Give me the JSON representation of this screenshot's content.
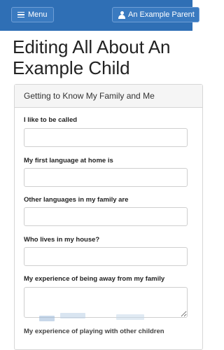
{
  "nav": {
    "menu_label": "Menu",
    "user_label": "An Example Parent"
  },
  "page": {
    "title_line1": "Editing All About An",
    "title_line2": "Example Child"
  },
  "panel": {
    "heading": "Getting to Know My Family and Me",
    "fields": [
      {
        "label": "I like to be called",
        "value": ""
      },
      {
        "label": "My first language at home is",
        "value": ""
      },
      {
        "label": "Other languages in my family are",
        "value": ""
      },
      {
        "label": "Who lives in my house?",
        "value": ""
      },
      {
        "label": "My experience of being away from my family",
        "value": ""
      },
      {
        "label": "My experience of playing with other children",
        "value": ""
      }
    ]
  },
  "colors": {
    "navbar": "#2f6fb5",
    "panel_heading_bg": "#f5f5f5"
  },
  "icons": {
    "menu": "hamburger-icon",
    "user": "user-icon"
  }
}
